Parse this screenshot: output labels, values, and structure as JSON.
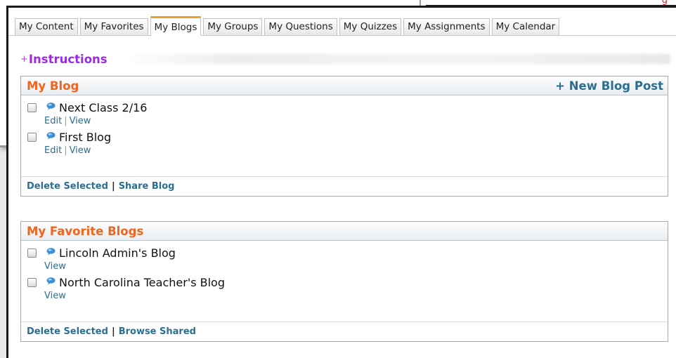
{
  "background": {
    "corner_text": "g"
  },
  "tabs": [
    {
      "label": "My Content",
      "active": false
    },
    {
      "label": "My Favorites",
      "active": false
    },
    {
      "label": "My Blogs",
      "active": true
    },
    {
      "label": "My Groups",
      "active": false
    },
    {
      "label": "My Questions",
      "active": false
    },
    {
      "label": "My Quizzes",
      "active": false
    },
    {
      "label": "My Assignments",
      "active": false
    },
    {
      "label": "My Calendar",
      "active": false
    }
  ],
  "instructions": {
    "plus": "+",
    "label": "Instructions"
  },
  "my_blog": {
    "title": "My Blog",
    "new_post_label": "+ New Blog Post",
    "entries": [
      {
        "title": "Next Class 2/16",
        "edit": "Edit",
        "sep": "|",
        "view": "View"
      },
      {
        "title": "First Blog",
        "edit": "Edit",
        "sep": "|",
        "view": "View"
      }
    ],
    "footer": {
      "delete": "Delete Selected",
      "sep": "|",
      "share": "Share Blog"
    }
  },
  "favorite_blogs": {
    "title": "My Favorite Blogs",
    "entries": [
      {
        "title": "Lincoln Admin's Blog",
        "view": "View"
      },
      {
        "title": "North Carolina Teacher's Blog",
        "view": "View"
      }
    ],
    "footer": {
      "delete": "Delete Selected",
      "sep": "|",
      "browse": "Browse Shared"
    }
  },
  "colors": {
    "panel_title": "#f06420",
    "link": "#2a6f91",
    "instructions": "#9a2be0",
    "active_tab_accent": "#f0a028"
  }
}
